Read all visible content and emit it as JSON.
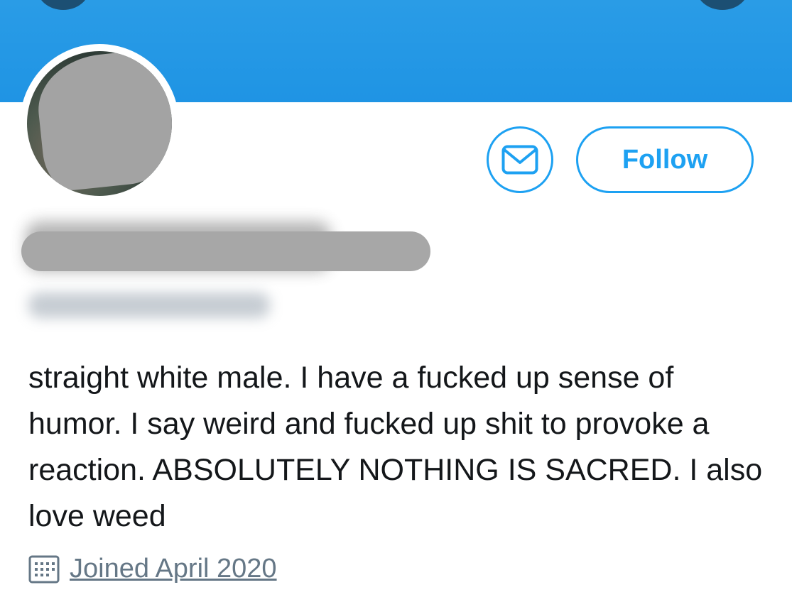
{
  "profile": {
    "follow_label": "Follow",
    "bio": "straight white male. I have a fucked up sense of humor. I say weird and fucked up shit to provoke a reaction. ABSOLUTELY NOTHING IS SACRED. I also love weed",
    "joined": "Joined April 2020"
  },
  "icons": {
    "message": "envelope-icon",
    "joined": "calendar-icon"
  },
  "colors": {
    "accent": "#1da1f2",
    "banner": "#1f94e4",
    "muted_text": "#657786",
    "text": "#14171a"
  }
}
